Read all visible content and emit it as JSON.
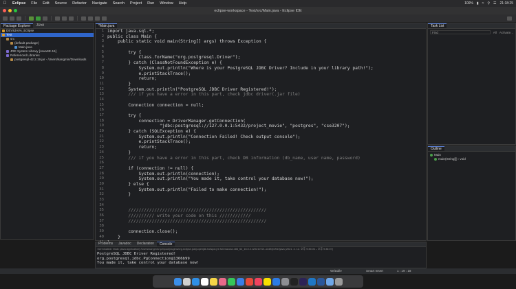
{
  "menubar": {
    "app_name": "Eclipse",
    "items": [
      "File",
      "Edit",
      "Source",
      "Refactor",
      "Navigate",
      "Search",
      "Project",
      "Run",
      "Window",
      "Help"
    ],
    "clock": "21:18:25",
    "battery": "100%"
  },
  "window": {
    "title": "eclipse-workspace - Test/src/Main.java - Eclipse IDE"
  },
  "package_explorer": {
    "tab_label": "Package Explorer",
    "tab2_label": "JUnit",
    "tree": [
      {
        "label": "DEV8JAVA_Eclipse",
        "indent": 0,
        "color": "#d99b2b"
      },
      {
        "label": "Test",
        "indent": 0,
        "color": "#d99b2b",
        "selected": true
      },
      {
        "label": "src",
        "indent": 1,
        "color": "#b58a47"
      },
      {
        "label": "(default package)",
        "indent": 2,
        "color": "#b58a47"
      },
      {
        "label": "Main.java",
        "indent": 3,
        "color": "#4d8fd1"
      },
      {
        "label": "JRE System Library [JavaSE-16]",
        "indent": 1,
        "color": "#7c6ad1"
      },
      {
        "label": "Referenced Libraries",
        "indent": 1,
        "color": "#7c6ad1"
      },
      {
        "label": "postgresql-42.2.19.jar - /Users/kangmin/Downloads",
        "indent": 2,
        "color": "#b58a47"
      }
    ]
  },
  "editor": {
    "tab_label": "*Main.java",
    "lines": [
      {
        "n": "1",
        "text": "import java.sql.*;"
      },
      {
        "n": "2",
        "text": "public class Main {"
      },
      {
        "n": "3",
        "text": "    public static void main(String[] args) throws Exception {"
      },
      {
        "n": "4",
        "text": ""
      },
      {
        "n": "5",
        "text": "        try {"
      },
      {
        "n": "6",
        "text": "            Class.forName(\"org.postgresql.Driver\");"
      },
      {
        "n": "7",
        "text": "        } catch (ClassNotFoundException e) {"
      },
      {
        "n": "8",
        "text": "            System.out.println(\"Where is your PostgreSQL JDBC Driver? Include in your library path!\");"
      },
      {
        "n": "9",
        "text": "            e.printStackTrace();"
      },
      {
        "n": "10",
        "text": "            return;"
      },
      {
        "n": "11",
        "text": "        }"
      },
      {
        "n": "12",
        "text": "        System.out.println(\"PostgreSQL JDBC Driver Registered!\");"
      },
      {
        "n": "13",
        "text": "        /// if you have a error in this part, check jdbc driver(.jar file)"
      },
      {
        "n": "14",
        "text": ""
      },
      {
        "n": "15",
        "text": "        Connection connection = null;"
      },
      {
        "n": "16",
        "text": ""
      },
      {
        "n": "17",
        "text": "        try {"
      },
      {
        "n": "18",
        "text": "            connection = DriverManager.getConnection("
      },
      {
        "n": "19",
        "text": "                    \"jdbc:postgresql://127.0.0.1:5432/project_movie\", \"postgres\", \"cse3207\");"
      },
      {
        "n": "20",
        "text": "        } catch (SQLException e) {"
      },
      {
        "n": "21",
        "text": "            System.out.println(\"Connection Failed! Check output console\");"
      },
      {
        "n": "22",
        "text": "            e.printStackTrace();"
      },
      {
        "n": "23",
        "text": "            return;"
      },
      {
        "n": "24",
        "text": "        }"
      },
      {
        "n": "25",
        "text": "        /// if you have a error in this part, check DB information (db_name, user name, password)"
      },
      {
        "n": "26",
        "text": ""
      },
      {
        "n": "27",
        "text": "        if (connection != null) {"
      },
      {
        "n": "28",
        "text": "            System.out.println(connection);"
      },
      {
        "n": "29",
        "text": "            System.out.println(\"You made it, take control your database now!\");"
      },
      {
        "n": "30",
        "text": "        } else {"
      },
      {
        "n": "31",
        "text": "            System.out.println(\"Failed to make connection!\");"
      },
      {
        "n": "32",
        "text": "        }"
      },
      {
        "n": "33",
        "text": ""
      },
      {
        "n": "34",
        "text": ""
      },
      {
        "n": "35",
        "text": "        /////////////////////////////////////////////////////"
      },
      {
        "n": "36",
        "text": "        ////////// write your code on this ////////////"
      },
      {
        "n": "37",
        "text": "        /////////////////////////////////////////////////////"
      },
      {
        "n": "38",
        "text": ""
      },
      {
        "n": "39",
        "text": "        connection.close();"
      },
      {
        "n": "40",
        "text": "    }"
      },
      {
        "n": "41",
        "text": "}"
      }
    ]
  },
  "task_list": {
    "tab_label": "Task List",
    "find_placeholder": "Find",
    "filter_all": "All",
    "activate": "Activate..."
  },
  "outline": {
    "tab_label": "Outline",
    "items": [
      {
        "label": "Main",
        "indent": 0
      },
      {
        "label": "main(String[]) : void",
        "indent": 1
      }
    ]
  },
  "console": {
    "tabs": [
      "Problems",
      "Javadoc",
      "Declaration",
      "Console"
    ],
    "active_tab": "Console",
    "status": "<terminated> Main [Java Application] /Users/kangmin/.p2/pool/plugins/org.eclipse.justj.openjdk.hotspot.jre.full.macosx.x86_64_16.0.2.v20210721-1149/jre/bin/java (2021. 4. 12. 오후 9:35:06 – 오후 9:35:07)",
    "lines": [
      "PostgreSQL JDBC Driver Registered!",
      "org.postgresql.jdbc.PgConnection@1366b99",
      "You made it, take control your database now!"
    ]
  },
  "statusbar": {
    "writable": "Writable",
    "insert_mode": "Smart Insert",
    "position": "1 : 19 : 18"
  },
  "colors": {
    "keyword": "#cc7832",
    "string": "#6a8759",
    "comment": "#808080",
    "method_static": "#ffc66d",
    "selection": "#2f65ca"
  },
  "dock": {
    "icons": [
      "finder-icon",
      "launchpad-icon",
      "safari-icon",
      "calendar-icon",
      "notes-icon",
      "photos-icon",
      "messages-icon",
      "mail-icon",
      "chrome-icon",
      "music-icon",
      "kakao-icon",
      "appstore-icon",
      "settings-icon",
      "terminal-icon",
      "eclipse-icon",
      "vscode-icon",
      "word-icon",
      "preview-icon",
      "trash-icon"
    ]
  }
}
